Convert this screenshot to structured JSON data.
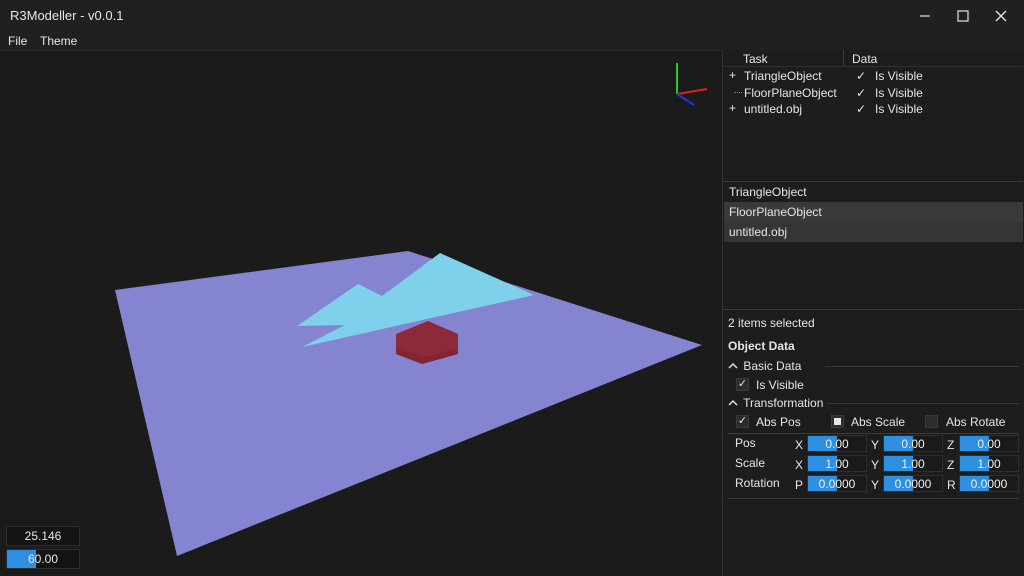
{
  "window": {
    "title": "R3Modeller - v0.0.1",
    "minimize_glyph": "—",
    "maximize_glyph": "☐",
    "close_glyph": "✕"
  },
  "menu": {
    "items": [
      "File",
      "Theme"
    ]
  },
  "tree": {
    "headers": [
      "Task",
      "Data"
    ],
    "rows": [
      {
        "expander": "+",
        "label": "TriangleObject",
        "check": "✓",
        "data": "Is Visible"
      },
      {
        "expander": "",
        "label": "FloorPlaneObject",
        "check": "✓",
        "data": "Is Visible"
      },
      {
        "expander": "+",
        "label": "untitled.obj",
        "check": "✓",
        "data": "Is Visible"
      }
    ]
  },
  "object_list": [
    "TriangleObject",
    "FloorPlaneObject",
    "untitled.obj"
  ],
  "properties": {
    "selection_summary": "2 items selected",
    "title": "Object Data",
    "basic_group": "Basic Data",
    "is_visible_label": "Is Visible",
    "is_visible_check": "✓",
    "transform_group": "Transformation",
    "abs_pos_label": "Abs Pos",
    "abs_pos_check": "✓",
    "abs_scale_label": "Abs Scale",
    "abs_rotate_label": "Abs Rotate",
    "rows": [
      {
        "label": "Pos",
        "axes": [
          "X",
          "Y",
          "Z"
        ],
        "values": [
          "0.00",
          "0.00",
          "0.00"
        ],
        "fill": [
          0.5,
          0.5,
          0.5
        ]
      },
      {
        "label": "Scale",
        "axes": [
          "X",
          "Y",
          "Z"
        ],
        "values": [
          "1.00",
          "1.00",
          "1.00"
        ],
        "fill": [
          0.5,
          0.5,
          0.5
        ]
      },
      {
        "label": "Rotation",
        "axes": [
          "P",
          "Y",
          "R"
        ],
        "values": [
          "0.0000",
          "0.0000",
          "0.0000"
        ],
        "fill": [
          0.5,
          0.5,
          0.5
        ]
      }
    ]
  },
  "stats": {
    "frame_time": "25.146",
    "fps": "60.00",
    "fps_fill": 0.4
  },
  "scene": {
    "floor_color": "#8484d0",
    "triangle_color": "#7fd0ea",
    "cube_color": "#8c2a3a",
    "gizmo_x_color": "#e02020",
    "gizmo_y_color": "#20d020",
    "gizmo_z_color": "#2030e0",
    "accent": "#2e8fe0"
  }
}
